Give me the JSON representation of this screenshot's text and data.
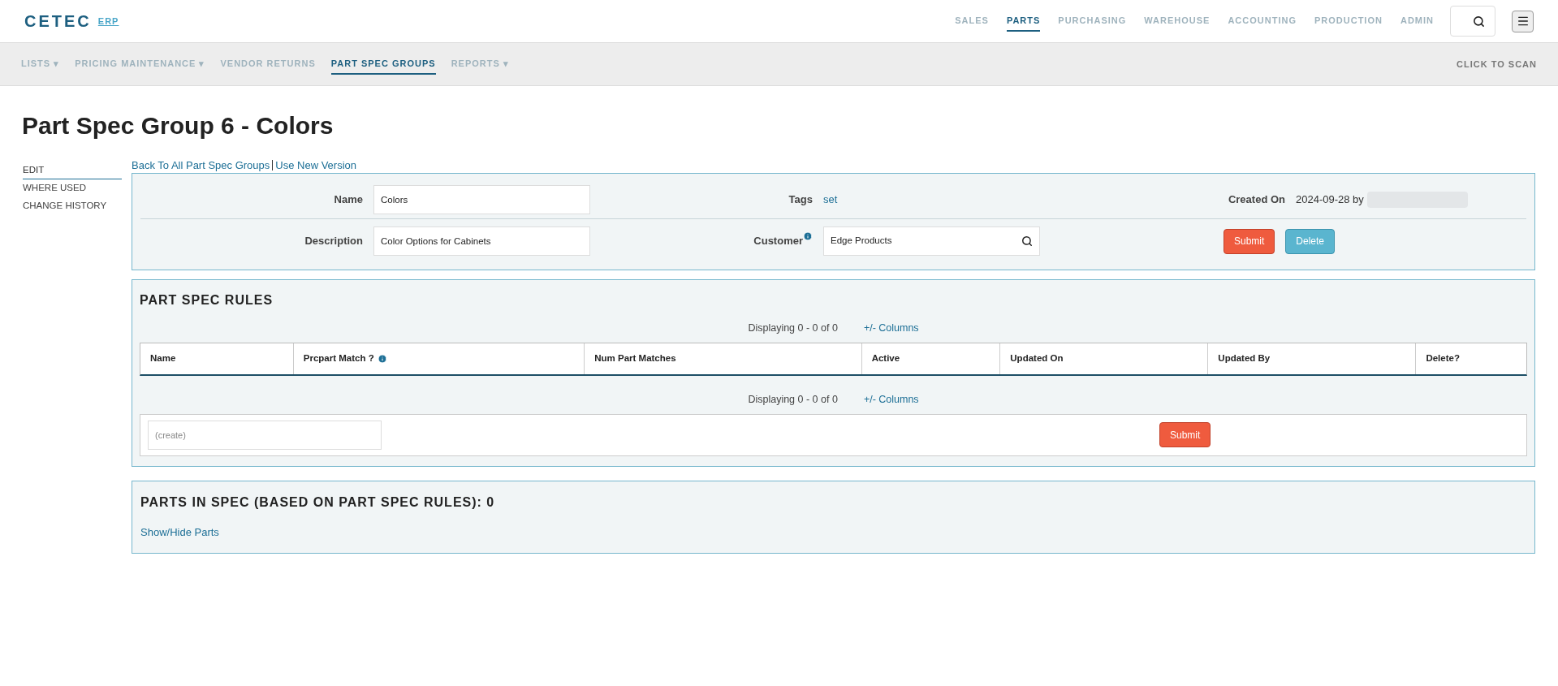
{
  "logo": {
    "main": "CETEC",
    "sub": "ERP"
  },
  "top_nav": [
    {
      "label": "SALES",
      "selected": false
    },
    {
      "label": "PARTS",
      "selected": true
    },
    {
      "label": "PURCHASING",
      "selected": false
    },
    {
      "label": "WAREHOUSE",
      "selected": false
    },
    {
      "label": "ACCOUNTING",
      "selected": false
    },
    {
      "label": "PRODUCTION",
      "selected": false
    },
    {
      "label": "ADMIN",
      "selected": false
    }
  ],
  "sub_nav": [
    {
      "label": "LISTS ▾",
      "selected": false
    },
    {
      "label": "PRICING MAINTENANCE ▾",
      "selected": false
    },
    {
      "label": "VENDOR RETURNS",
      "selected": false
    },
    {
      "label": "PART SPEC GROUPS",
      "selected": true
    },
    {
      "label": "REPORTS ▾",
      "selected": false
    }
  ],
  "scan_link": "CLICK TO SCAN",
  "page_title": "Part Spec Group 6 - Colors",
  "side_menu": [
    {
      "label": "EDIT",
      "selected": true
    },
    {
      "label": "WHERE USED",
      "selected": false
    },
    {
      "label": "CHANGE HISTORY",
      "selected": false
    }
  ],
  "breadcrumbs": [
    "Back To All Part Spec Groups",
    "Use New Version"
  ],
  "form": {
    "name_label": "Name",
    "name_value": "Colors",
    "tags_label": "Tags",
    "tags_link": "set",
    "created_label": "Created On",
    "created_value": "2024-09-28 by",
    "description_label": "Description",
    "description_value": "Color Options for Cabinets",
    "customer_label": "Customer",
    "customer_value": "Edge Products",
    "submit": "Submit",
    "delete": "Delete"
  },
  "rules": {
    "title": "PART SPEC RULES",
    "displaying": "Displaying 0 - 0 of 0",
    "columns_link": "+/- Columns",
    "columns": [
      "Name",
      "Prcpart Match ?",
      "Num Part Matches",
      "Active",
      "Updated On",
      "Updated By",
      "Delete?"
    ],
    "displaying_bottom": "Displaying 0 - 0 of 0",
    "columns_link_bottom": "+/- Columns",
    "create_placeholder": "(create)",
    "submit": "Submit"
  },
  "parts_in_spec": {
    "title": "PARTS IN SPEC (BASED ON PART SPEC RULES): 0",
    "toggle_link": "Show/Hide Parts"
  }
}
